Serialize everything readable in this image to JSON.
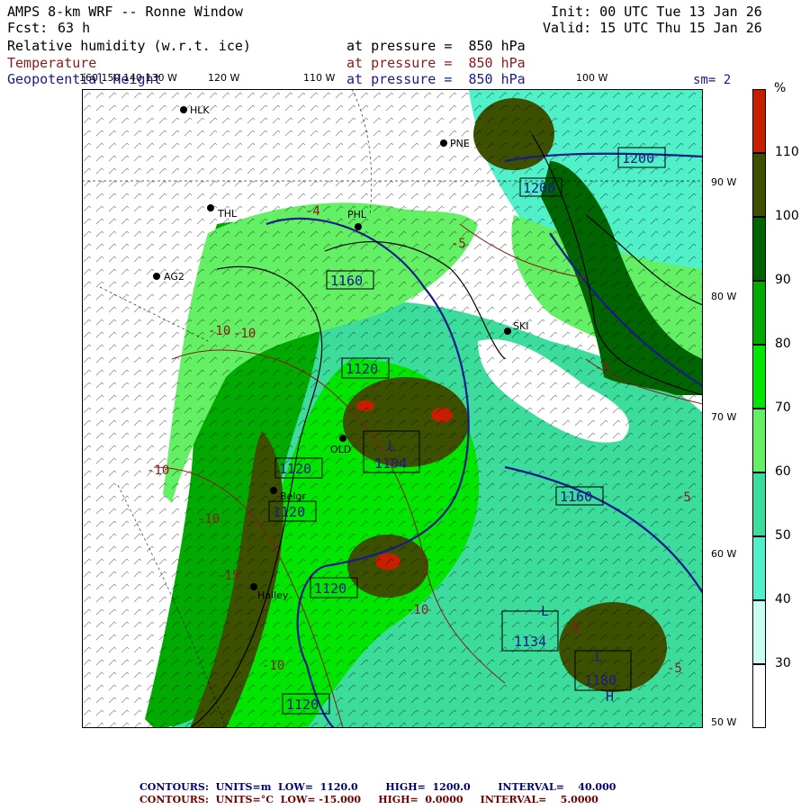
{
  "header": {
    "title": "AMPS 8-km WRF -- Ronne Window",
    "fcst_label": "Fcst:",
    "fcst_value": "63 h",
    "init": "Init: 00 UTC Tue 13 Jan 26",
    "valid": "Valid: 15 UTC Thu 15 Jan 26",
    "fields": [
      {
        "name": "Relative humidity (w.r.t. ice)",
        "pressure": "at pressure =  850 hPa"
      },
      {
        "name": "Temperature",
        "pressure": "at pressure =  850 hPa"
      },
      {
        "name": "Geopotential Height",
        "pressure": "at pressure =  850 hPa"
      }
    ],
    "sm": "sm= 2"
  },
  "longitude_labels": [
    "160 150 140 130 W",
    "120 W",
    "110 W",
    "100 W"
  ],
  "latitude_labels": [
    "90 W",
    "80 W",
    "70 W",
    "60 W",
    "50 W"
  ],
  "stations": [
    "HLK",
    "PNE",
    "THL",
    "PHL",
    "AG2",
    "SKI",
    "OLD",
    "Belgr",
    "Halley"
  ],
  "height_labels": [
    "1200",
    "1200",
    "1160",
    "1160",
    "1120",
    "1120",
    "1120",
    "1120",
    "1120",
    "1104",
    "1134",
    "1180",
    "1120"
  ],
  "temp_labels": [
    "-10",
    "-10",
    "-10",
    "-5",
    "-5",
    "-15",
    "-10",
    "-5",
    "-10",
    "-4",
    "-10",
    "-5",
    "-5"
  ],
  "extrema_labels": [
    "L",
    "L",
    "L",
    "H"
  ],
  "colorbar": {
    "unit": "%",
    "ticks": [
      "110",
      "100",
      "90",
      "80",
      "70",
      "60",
      "50",
      "40",
      "30"
    ],
    "colors": [
      "#c81e00",
      "#3c5000",
      "#006400",
      "#00aa00",
      "#00e600",
      "#64f064",
      "#3cdc9c",
      "#50f0c8",
      "#c8fff0",
      "#ffffff"
    ]
  },
  "footer": [
    {
      "label": "CONTOURS:",
      "units": "UNITS=m",
      "low": "LOW=  1120.0",
      "high": "HIGH=  1200.0",
      "interval": "INTERVAL=    40.000"
    },
    {
      "label": "CONTOURS:",
      "units": "UNITS=°C",
      "low": "LOW= -15.000",
      "high": "HIGH=  0.0000",
      "interval": "INTERVAL=    5.0000"
    }
  ]
}
